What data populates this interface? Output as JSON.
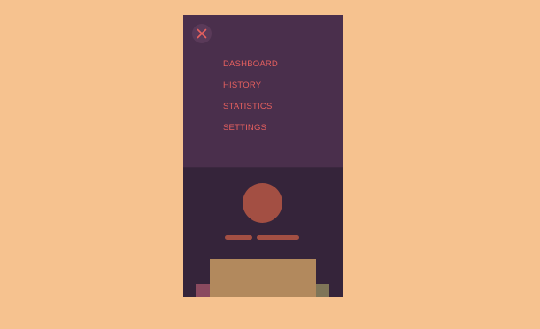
{
  "menu": {
    "close_icon": "close-icon",
    "items": [
      {
        "label": "DASHBOARD"
      },
      {
        "label": "HISTORY"
      },
      {
        "label": "STATISTICS"
      },
      {
        "label": "SETTINGS"
      }
    ]
  },
  "colors": {
    "page_background": "#f6c28f",
    "menu_panel": "#4a2f4c",
    "app_background": "#35243a",
    "accent": "#e6605f",
    "avatar": "#a34f43",
    "card_center": "#b2895d",
    "card_left": "#8a4a5f",
    "card_right": "#7f7558"
  }
}
